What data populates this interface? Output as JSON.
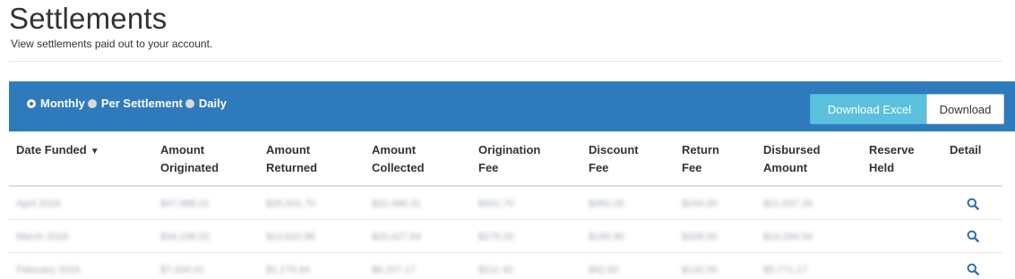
{
  "header": {
    "title": "Settlements",
    "subtitle": "View settlements paid out to your account."
  },
  "filters": {
    "options": [
      {
        "label": "Monthly",
        "selected": true
      },
      {
        "label": "Per Settlement",
        "selected": false
      },
      {
        "label": "Daily",
        "selected": false
      }
    ]
  },
  "toolbar": {
    "download_excel_label": "Download Excel",
    "download_label": "Download"
  },
  "table": {
    "columns": [
      {
        "line1": "Date Funded",
        "line2": "",
        "sort_indicator": "▼"
      },
      {
        "line1": "Amount",
        "line2": "Originated"
      },
      {
        "line1": "Amount",
        "line2": "Returned"
      },
      {
        "line1": "Amount",
        "line2": "Collected"
      },
      {
        "line1": "Origination",
        "line2": "Fee"
      },
      {
        "line1": "Discount",
        "line2": "Fee"
      },
      {
        "line1": "Return",
        "line2": "Fee"
      },
      {
        "line1": "Disbursed",
        "line2": "Amount"
      },
      {
        "line1": "Reserve",
        "line2": "Held"
      },
      {
        "line1": "Detail",
        "line2": ""
      }
    ],
    "rows": [
      {
        "date": "April 2016",
        "originated": "$47,988.01",
        "returned": "$20,501.70",
        "collected": "$22,486.31",
        "origination_fee": "$301.70",
        "discount_fee": "$350.26",
        "return_fee": "$244.00",
        "disbursed": "$21,637.33",
        "reserve": ""
      },
      {
        "date": "March 2016",
        "originated": "$34,238.52",
        "returned": "$13,610.86",
        "collected": "$20,427.64",
        "origination_fee": "$275.20",
        "discount_fee": "$193.90",
        "return_fee": "$328.00",
        "disbursed": "$19,294.54",
        "reserve": ""
      },
      {
        "date": "February 2016",
        "originated": "$7,334.01",
        "returned": "$1,176.84",
        "collected": "$6,157.17",
        "origination_fee": "$211.40",
        "discount_fee": "$42.60",
        "return_fee": "$132.00",
        "disbursed": "$5,771.17",
        "reserve": ""
      }
    ],
    "detail_icon": "search-icon"
  },
  "colors": {
    "toolbar_bg": "#2f7abd",
    "excel_button_bg": "#5bc0de",
    "detail_icon": "#2a6fb5"
  }
}
